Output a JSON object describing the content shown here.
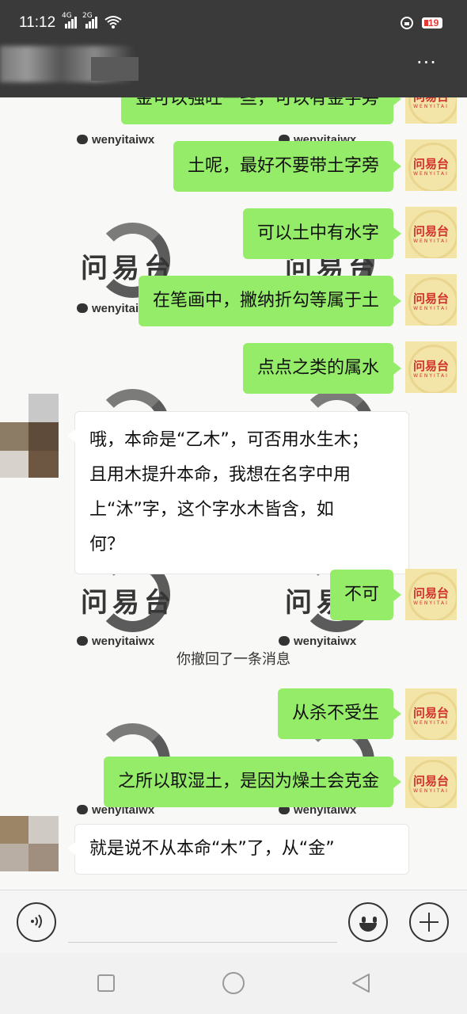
{
  "status_bar": {
    "time": "11:12",
    "network1": "4G",
    "network2": "2G",
    "battery": "19"
  },
  "header": {
    "more_label": "···"
  },
  "messages": [
    {
      "side": "me",
      "text": "金可以强旺一些，可以有金字旁"
    },
    {
      "side": "me",
      "text": "土呢，最好不要带土字旁"
    },
    {
      "side": "me",
      "text": "可以土中有水字"
    },
    {
      "side": "me",
      "text": "在笔画中，撇纳折勾等属于土"
    },
    {
      "side": "me",
      "text": "点点之类的属水"
    },
    {
      "side": "other",
      "lines": [
        "哦，本命是“乙木”，可否用水生木；",
        "且用木提升本命，我想在名字中用",
        "上“沐”字，这个字水木皆含，如",
        "何？"
      ]
    },
    {
      "side": "me",
      "text": "不可"
    },
    {
      "side": "system",
      "text": "你撤回了一条消息"
    },
    {
      "side": "me",
      "text": "从杀不受生"
    },
    {
      "side": "me",
      "text": "之所以取湿土，是因为燥土会克金"
    },
    {
      "side": "other",
      "lines": [
        "就是说不从本命“木”了，从“金”"
      ]
    }
  ],
  "avatar_me": {
    "label": "问易台",
    "sub": "WENYITAI"
  },
  "watermark": {
    "logo_text": "问易台",
    "account": "wenyitaiwx"
  },
  "colors": {
    "bubble_me": "#95ec69",
    "bubble_other": "#ffffff",
    "header_bg": "#3a3a3a",
    "battery_low": "#e53935"
  },
  "input_bar": {
    "voice_icon": "voice-icon",
    "emoji_icon": "emoji-icon",
    "plus_icon": "plus-icon"
  }
}
